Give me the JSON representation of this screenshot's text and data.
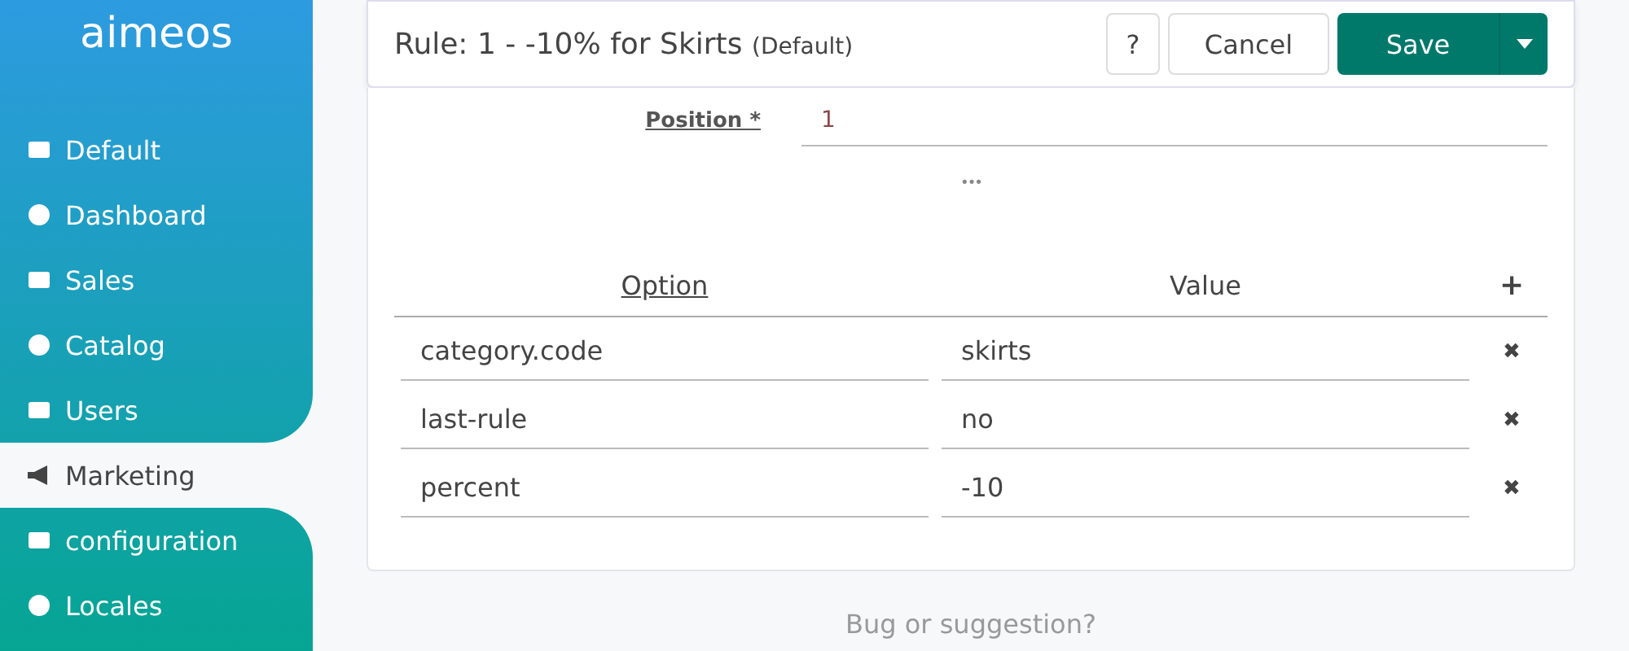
{
  "logo": "aimeos",
  "sidebar": {
    "items": [
      {
        "label": "Default",
        "selected": false
      },
      {
        "label": "Dashboard",
        "selected": false
      },
      {
        "label": "Sales",
        "selected": false
      },
      {
        "label": "Catalog",
        "selected": false
      },
      {
        "label": "Users",
        "selected": false
      },
      {
        "label": "Marketing",
        "selected": true
      },
      {
        "label": "configuration",
        "selected": false
      },
      {
        "label": "Locales",
        "selected": false
      }
    ]
  },
  "header": {
    "title": "Rule: 1 - -10% for Skirts",
    "subtitle": "(Default)",
    "help": "?",
    "cancel": "Cancel",
    "save": "Save"
  },
  "position": {
    "label": "Position *",
    "value": "1"
  },
  "more": "•••",
  "table": {
    "columns": [
      "Option",
      "Value"
    ],
    "add": "+",
    "rows": [
      {
        "option": "category.code",
        "value": "skirts",
        "remove": "✖"
      },
      {
        "option": "last-rule",
        "value": "no",
        "remove": "✖"
      },
      {
        "option": "percent",
        "value": "-10",
        "remove": "✖"
      }
    ]
  },
  "footer": "Bug or suggestion?"
}
